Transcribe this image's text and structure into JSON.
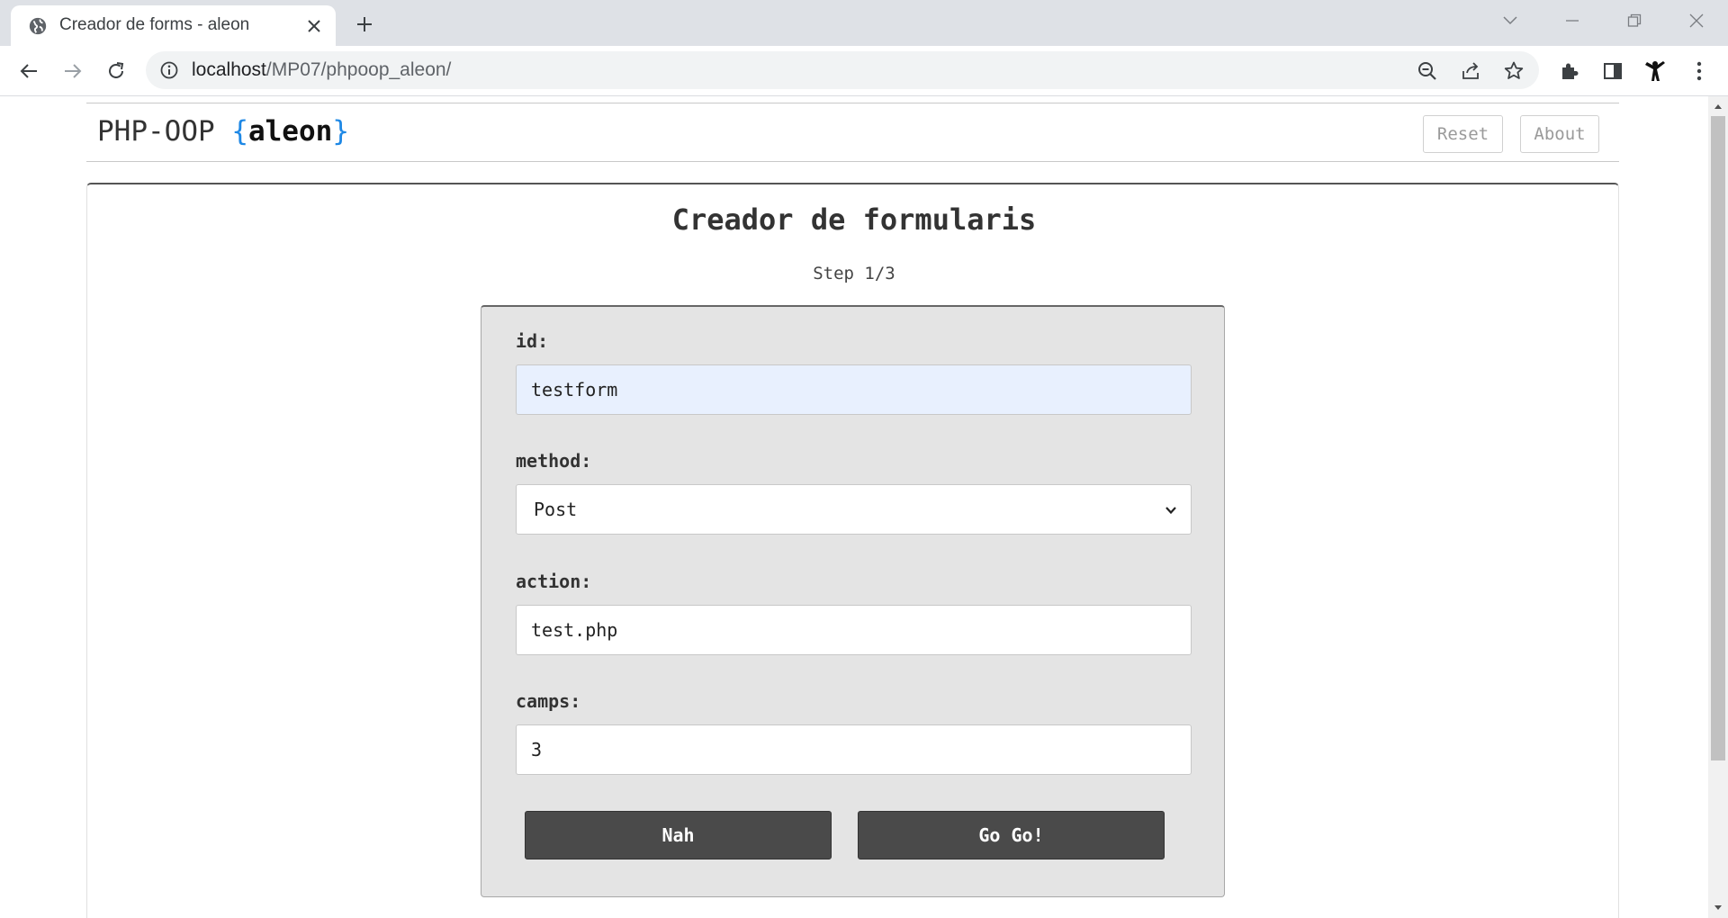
{
  "browser": {
    "tab": {
      "title": "Creador de forms - aleon"
    },
    "url": {
      "host": "localhost",
      "path": "/MP07/phpoop_aleon/"
    }
  },
  "header": {
    "brand": {
      "prefix": "PHP-OOP ",
      "open_brace": "{",
      "name": "aleon",
      "close_brace": "}"
    },
    "reset_label": "Reset",
    "about_label": "About"
  },
  "main": {
    "title": "Creador de formularis",
    "step": "Step 1/3",
    "form": {
      "fields": [
        {
          "label": "id:",
          "value": "testform"
        },
        {
          "label": "method:",
          "value": "Post"
        },
        {
          "label": "action:",
          "value": "test.php"
        },
        {
          "label": "camps:",
          "value": "3"
        }
      ],
      "cancel_label": "Nah",
      "submit_label": "Go Go!"
    }
  },
  "colors": {
    "accent_brace": "#1e88e5",
    "button_dark": "#4a4a4a",
    "form_background": "#e4e4e4",
    "autofill_background": "#e8f0fe"
  }
}
